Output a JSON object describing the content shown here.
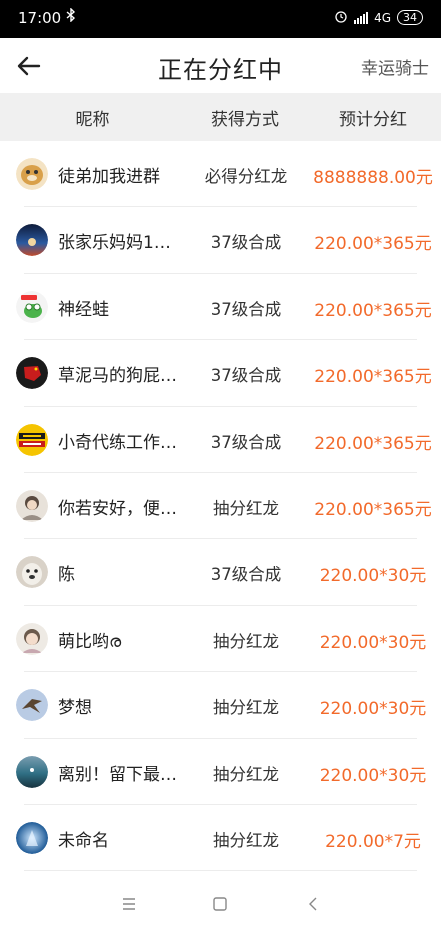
{
  "status_bar": {
    "time": "17:00",
    "bluetooth_icon": "bluetooth-icon",
    "alarm_icon": "alarm-icon",
    "network": "4G",
    "battery": "34"
  },
  "nav": {
    "back_icon": "back-arrow-icon",
    "title": "正在分红中",
    "right_label": "幸运骑士"
  },
  "table": {
    "headers": [
      "昵称",
      "获得方式",
      "预计分红"
    ],
    "rows": [
      {
        "nickname": "徒弟加我进群",
        "method": "必得分红龙",
        "amount": "8888888.00元",
        "avatar_color": "#d9a04a"
      },
      {
        "nickname": "张家乐妈妈1…",
        "method": "37级合成",
        "amount": "220.00*365元",
        "avatar_color": "#1f3f7a"
      },
      {
        "nickname": "神经蛙",
        "method": "37级合成",
        "amount": "220.00*365元",
        "avatar_color": "#4bb34b"
      },
      {
        "nickname": "草泥马的狗屁…",
        "method": "37级合成",
        "amount": "220.00*365元",
        "avatar_color": "#c81d1d"
      },
      {
        "nickname": "小奇代练工作…",
        "method": "37级合成",
        "amount": "220.00*365元",
        "avatar_color": "#f5c400"
      },
      {
        "nickname": "你若安好，便…",
        "method": "抽分红龙",
        "amount": "220.00*365元",
        "avatar_color": "#9a8f86"
      },
      {
        "nickname": "陈",
        "method": "37级合成",
        "amount": "220.00*30元",
        "avatar_color": "#c9c2b8"
      },
      {
        "nickname": "萌比哟ര",
        "method": "抽分红龙",
        "amount": "220.00*30元",
        "avatar_color": "#d8d0c6"
      },
      {
        "nickname": "梦想",
        "method": "抽分红龙",
        "amount": "220.00*30元",
        "avatar_color": "#8aa6c8"
      },
      {
        "nickname": "离别！留下最…",
        "method": "抽分红龙",
        "amount": "220.00*30元",
        "avatar_color": "#2f6f84"
      },
      {
        "nickname": "未命名",
        "method": "抽分红龙",
        "amount": "220.00*7元",
        "avatar_color": "#2b6ea8"
      }
    ]
  },
  "bottom_nav": {
    "menu_icon": "menu-icon",
    "home_icon": "home-icon",
    "back_icon": "back-icon"
  },
  "colors": {
    "accent_amount": "#f26a2b",
    "header_bg": "#f0f0f0",
    "status_bg": "#000000"
  }
}
